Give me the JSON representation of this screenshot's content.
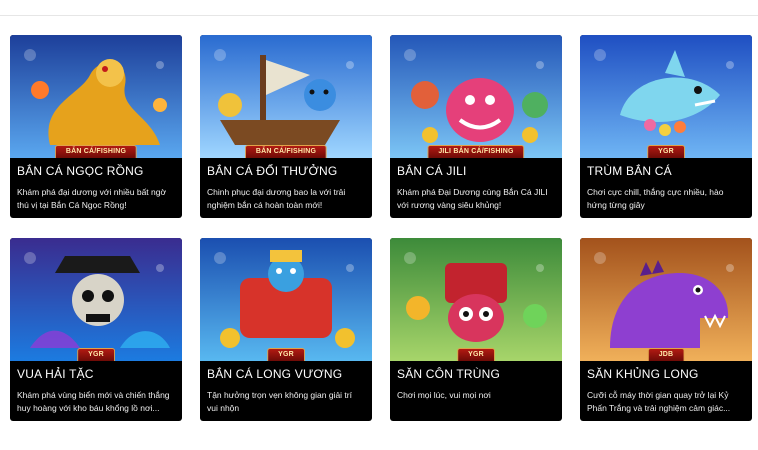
{
  "games": [
    {
      "title": "BẮN CÁ NGỌC RỒNG",
      "description": "Khám phá đại dương với nhiều bất ngờ thú vị tại Bắn Cá Ngọc Rồng!",
      "badge": "BẮN CÁ/FISHING",
      "art": "dragon",
      "bg": [
        "#1d3f9a",
        "#5aa7ef"
      ],
      "accent": "#e6a21c"
    },
    {
      "title": "BẮN CÁ ĐỔI THƯỞNG",
      "description": "Chinh phục đại dương bao la với trải nghiệm bắn cá hoàn toàn mới!",
      "badge": "BẮN CÁ/FISHING",
      "art": "pirate-ship",
      "bg": [
        "#2a6bd0",
        "#9fd6ff"
      ],
      "accent": "#3b8de0"
    },
    {
      "title": "BẮN CÁ JILI",
      "description": "Khám phá Đại Dương cùng Bắn Cá JILI với rương vàng siêu khủng!",
      "badge": "JILI BẮN CÁ/FISHING",
      "art": "monster-crew",
      "bg": [
        "#2457b8",
        "#7cc5f5"
      ],
      "accent": "#e5407a"
    },
    {
      "title": "TRÙM BẮN CÁ",
      "description": "Chơi cực chill, thắng cực nhiều, hào hứng từng giây",
      "badge": "YGR",
      "art": "shark",
      "bg": [
        "#1f4fc2",
        "#6fb5f4"
      ],
      "accent": "#7fd6ee"
    },
    {
      "title": "VUA HẢI TẶC",
      "description": "Khám phá vùng biển mới và chiến thắng huy hoàng với kho báu khổng lồ nơi...",
      "badge": "YGR",
      "art": "skull-pirate",
      "bg": [
        "#3a2c8f",
        "#1c7be0"
      ],
      "accent": "#8f3bd6"
    },
    {
      "title": "BẮN CÁ LONG VƯƠNG",
      "description": "Tận hưởng trọn vẹn không gian giải trí vui nhộn",
      "badge": "YGR",
      "art": "dragon-king",
      "bg": [
        "#1b4fb0",
        "#58b8f0"
      ],
      "accent": "#d7332a"
    },
    {
      "title": "SĂN CÔN TRÙNG",
      "description": "Chơi mọi lúc, vui mọi nơi",
      "badge": "YGR",
      "art": "insect",
      "bg": [
        "#3d8b3a",
        "#a7d56a"
      ],
      "accent": "#d8355d"
    },
    {
      "title": "SĂN KHỦNG LONG",
      "description": "Cưỡi cỗ máy thời gian quay trở lại Kỷ Phấn Trắng và trải nghiệm cảm giác...",
      "badge": "JDB",
      "art": "dinosaur",
      "bg": [
        "#a3521c",
        "#f0b05a"
      ],
      "accent": "#8e3fd0"
    }
  ]
}
